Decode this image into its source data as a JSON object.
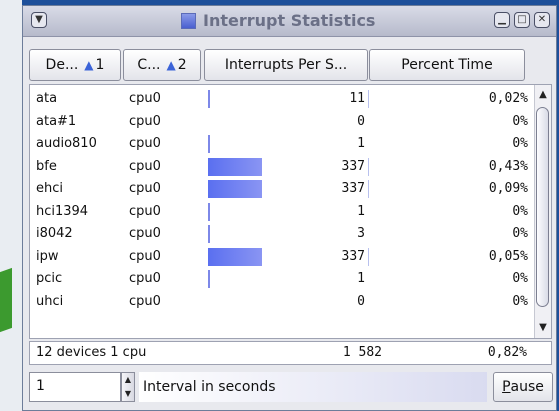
{
  "window": {
    "title": "Interrupt Statistics"
  },
  "columns": [
    {
      "label": "De...",
      "sort_order": "1"
    },
    {
      "label": "C...",
      "sort_order": "2"
    },
    {
      "label": "Interrupts Per S..."
    },
    {
      "label": "Percent Time"
    }
  ],
  "rows": [
    {
      "device": "ata",
      "cpu": "cpu0",
      "interrupts": "11",
      "percent": "0,02%",
      "bar_fraction": 0.0
    },
    {
      "device": "ata#1",
      "cpu": "cpu0",
      "interrupts": "0",
      "percent": "0%",
      "bar_fraction": 0.0
    },
    {
      "device": "audio810",
      "cpu": "cpu0",
      "interrupts": "1",
      "percent": "0%",
      "bar_fraction": 0.0
    },
    {
      "device": "bfe",
      "cpu": "cpu0",
      "interrupts": "337",
      "percent": "0,43%",
      "bar_fraction": 1.0
    },
    {
      "device": "ehci",
      "cpu": "cpu0",
      "interrupts": "337",
      "percent": "0,09%",
      "bar_fraction": 1.0
    },
    {
      "device": "hci1394",
      "cpu": "cpu0",
      "interrupts": "1",
      "percent": "0%",
      "bar_fraction": 0.0
    },
    {
      "device": "i8042",
      "cpu": "cpu0",
      "interrupts": "3",
      "percent": "0%",
      "bar_fraction": 0.0
    },
    {
      "device": "ipw",
      "cpu": "cpu0",
      "interrupts": "337",
      "percent": "0,05%",
      "bar_fraction": 1.0
    },
    {
      "device": "pcic",
      "cpu": "cpu0",
      "interrupts": "1",
      "percent": "0%",
      "bar_fraction": 0.0
    },
    {
      "device": "uhci",
      "cpu": "cpu0",
      "interrupts": "0",
      "percent": "0%",
      "bar_fraction": 0.0
    }
  ],
  "summary": {
    "devices": "12 devices 1 cpu",
    "total_interrupts": "1 582",
    "total_percent": "0,82%"
  },
  "interval": {
    "value": "1",
    "label": "Interval in seconds"
  },
  "pause_button": {
    "mnemonic": "P",
    "rest": "ause"
  },
  "colors": {
    "bar": "#5a6ff0",
    "sort_arrow": "#3b63d8"
  },
  "icons": {
    "window_menu": "chevron-down-icon",
    "minimize": "minimize-icon",
    "maximize": "maximize-icon",
    "close": "close-icon",
    "scroll_up": "arrow-up-icon",
    "scroll_down": "arrow-down-icon"
  }
}
